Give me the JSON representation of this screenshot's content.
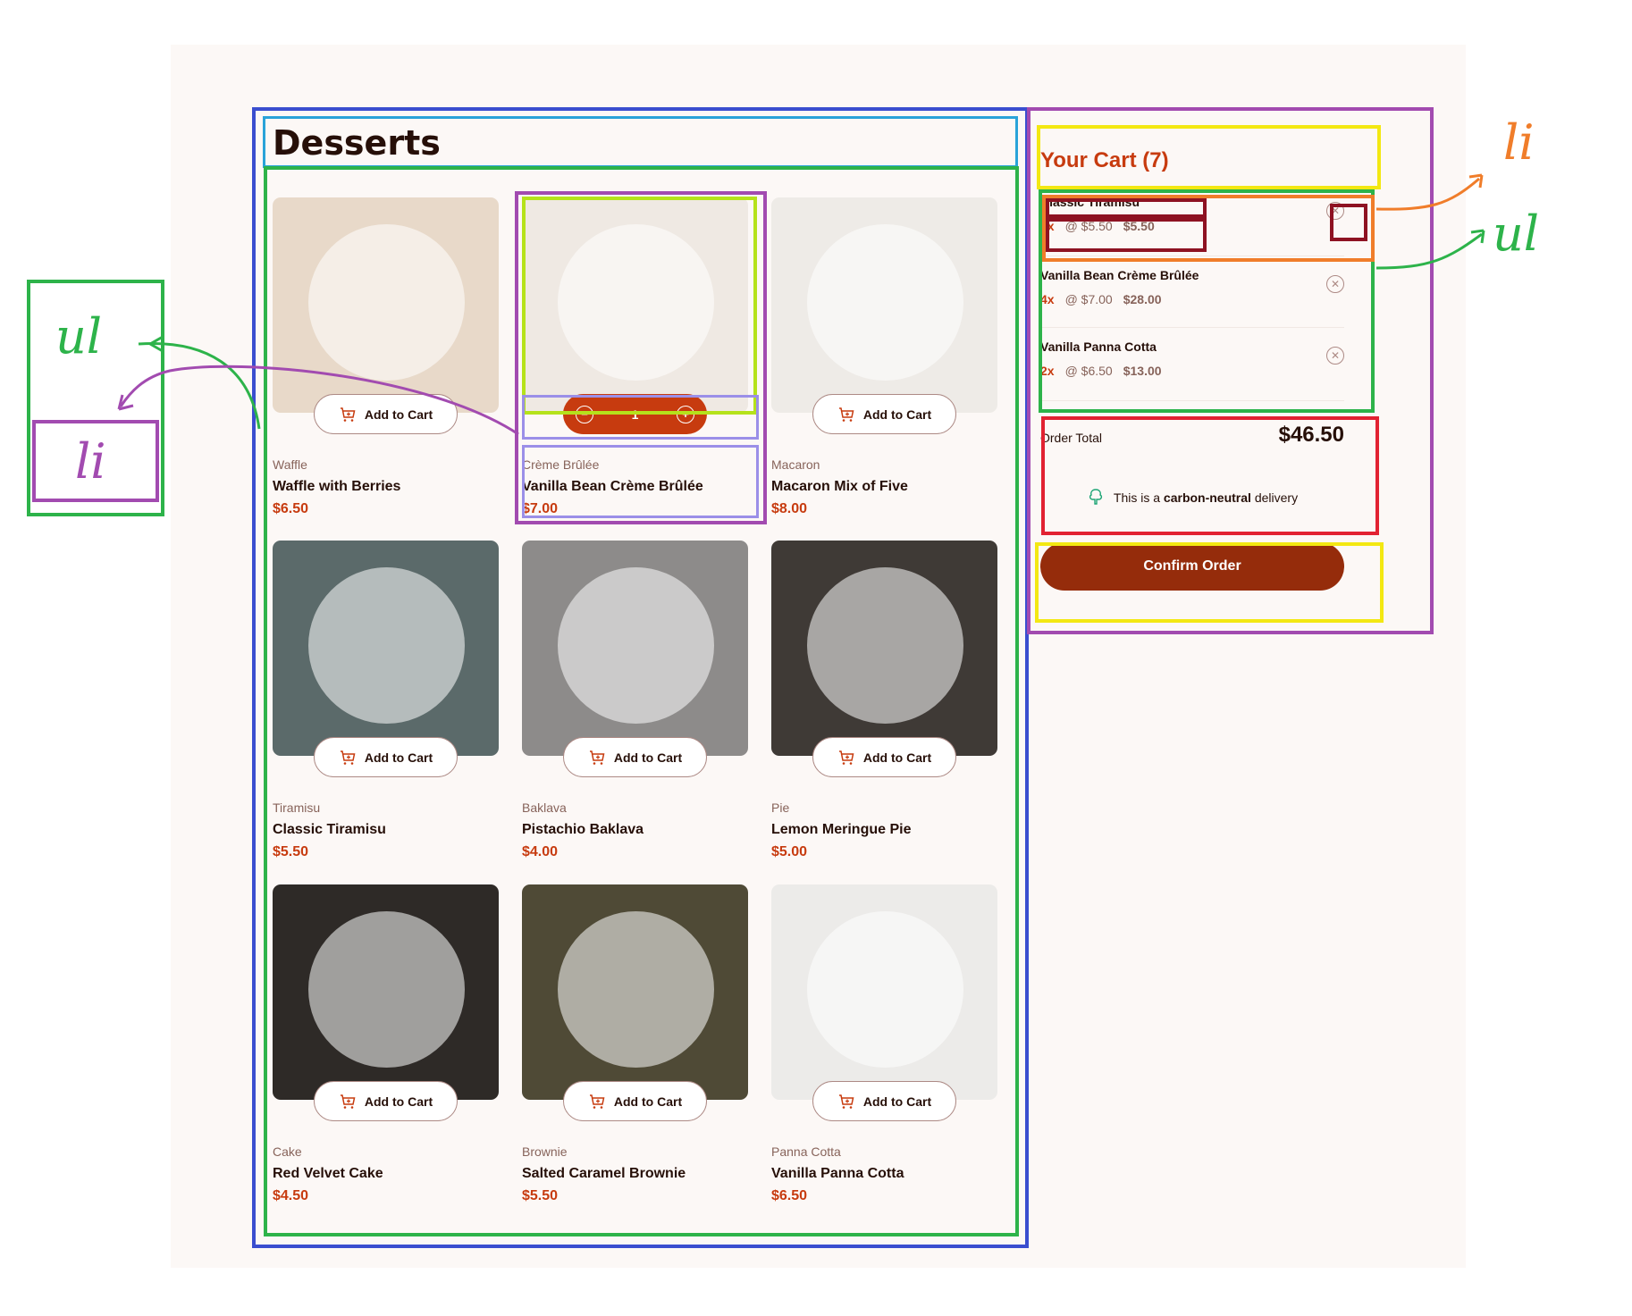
{
  "page": {
    "title": "Desserts"
  },
  "products": [
    {
      "category": "Waffle",
      "name": "Waffle with Berries",
      "price": "$6.50",
      "button": "Add to Cart",
      "state": "default",
      "bg": "#e8d9c9"
    },
    {
      "category": "Crème Brûlée",
      "name": "Vanilla Bean Crème Brûlée",
      "price": "$7.00",
      "state": "quantity",
      "quantity": "1",
      "bg": "#efe9e3"
    },
    {
      "category": "Macaron",
      "name": "Macaron Mix of Five",
      "price": "$8.00",
      "button": "Add to Cart",
      "state": "default",
      "bg": "#eeebe7"
    },
    {
      "category": "Tiramisu",
      "name": "Classic Tiramisu",
      "price": "$5.50",
      "button": "Add to Cart",
      "state": "default",
      "bg": "#5b6a6a"
    },
    {
      "category": "Baklava",
      "name": "Pistachio Baklava",
      "price": "$4.00",
      "button": "Add to Cart",
      "state": "default",
      "bg": "#8d8b8a"
    },
    {
      "category": "Pie",
      "name": "Lemon Meringue Pie",
      "price": "$5.00",
      "button": "Add to Cart",
      "state": "default",
      "bg": "#3f3a36"
    },
    {
      "category": "Cake",
      "name": "Red Velvet Cake",
      "price": "$4.50",
      "button": "Add to Cart",
      "state": "default",
      "bg": "#2e2a27"
    },
    {
      "category": "Brownie",
      "name": "Salted Caramel Brownie",
      "price": "$5.50",
      "button": "Add to Cart",
      "state": "default",
      "bg": "#4f4a36"
    },
    {
      "category": "Panna Cotta",
      "name": "Vanilla Panna Cotta",
      "price": "$6.50",
      "button": "Add to Cart",
      "state": "default",
      "bg": "#ecebe9"
    }
  ],
  "cart": {
    "title": "Your Cart (7)",
    "items": [
      {
        "name": "Classic Tiramisu",
        "qty": "1x",
        "unit": "@ $5.50",
        "total": "$5.50"
      },
      {
        "name": "Vanilla Bean Crème Brûlée",
        "qty": "4x",
        "unit": "@ $7.00",
        "total": "$28.00"
      },
      {
        "name": "Vanilla Panna Cotta",
        "qty": "2x",
        "unit": "@ $6.50",
        "total": "$13.00"
      }
    ],
    "order_total_label": "Order Total",
    "order_total": "$46.50",
    "carbon_prefix": "This is a",
    "carbon_bold": "carbon-neutral",
    "carbon_suffix": "delivery",
    "confirm": "Confirm Order"
  },
  "annotations": {
    "left_ul": "ul",
    "left_li": "li",
    "right_li": "li",
    "right_ul": "ul"
  },
  "colors": {
    "red": "#c73b0f",
    "dark": "#260f08",
    "rose": "#87635a",
    "bg": "#fcf8f6"
  }
}
